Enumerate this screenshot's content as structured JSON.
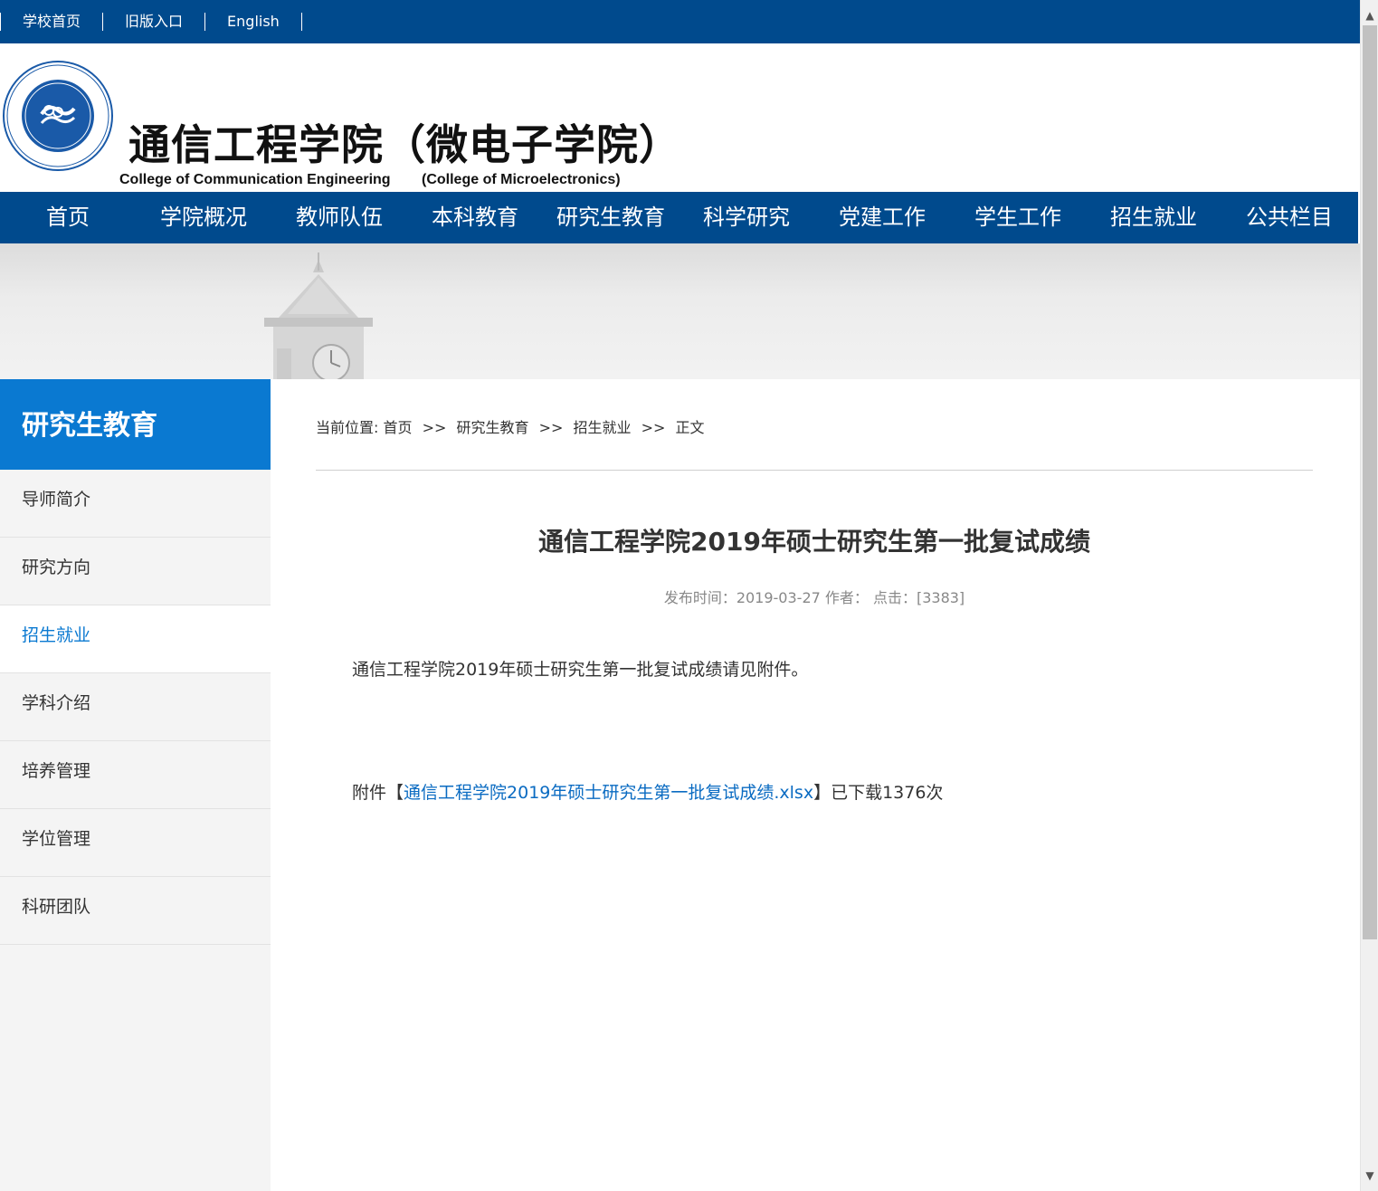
{
  "topbar": {
    "links": [
      "学校首页",
      "旧版入口",
      "English"
    ]
  },
  "header": {
    "title_cn": "通信工程学院（微电子学院）",
    "title_en": "College of Communication Engineering",
    "title_en_sub": "(College of Microelectronics)"
  },
  "nav": {
    "items": [
      "首页",
      "学院概况",
      "教师队伍",
      "本科教育",
      "研究生教育",
      "科学研究",
      "党建工作",
      "学生工作",
      "招生就业",
      "公共栏目"
    ]
  },
  "sidebar": {
    "title": "研究生教育",
    "items": [
      {
        "label": "导师简介",
        "active": false
      },
      {
        "label": "研究方向",
        "active": false
      },
      {
        "label": "招生就业",
        "active": true
      },
      {
        "label": "学科介绍",
        "active": false
      },
      {
        "label": "培养管理",
        "active": false
      },
      {
        "label": "学位管理",
        "active": false
      },
      {
        "label": "科研团队",
        "active": false
      }
    ]
  },
  "breadcrumb": {
    "prefix": "当前位置:",
    "items": [
      "首页",
      "研究生教育",
      "招生就业",
      "正文"
    ],
    "separator": ">>"
  },
  "article": {
    "title": "通信工程学院2019年硕士研究生第一批复试成绩",
    "meta": "发布时间：2019-03-27 作者：  点击：[3383]",
    "body": "通信工程学院2019年硕士研究生第一批复试成绩请见附件。",
    "attachment_prefix": "附件【",
    "attachment_link": "通信工程学院2019年硕士研究生第一批复试成绩.xlsx",
    "attachment_suffix": "】已下载1376次"
  },
  "colors": {
    "brand_blue": "#004a8d",
    "accent_blue": "#0a79d1",
    "link_blue": "#0a6bc2"
  }
}
